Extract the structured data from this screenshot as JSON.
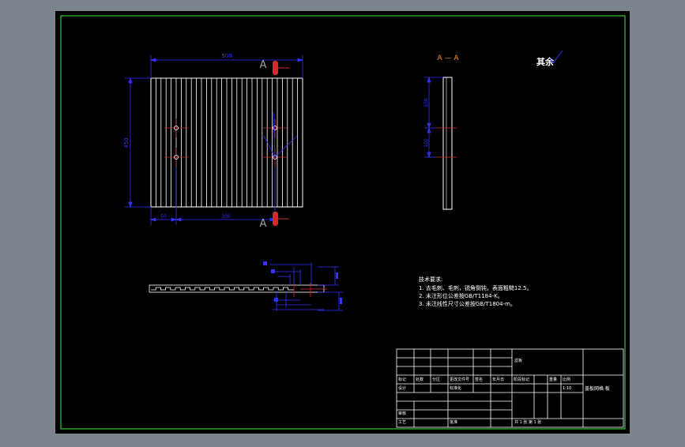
{
  "colors": {
    "background": "#7b848d",
    "sheet": "#000000",
    "border": "#39c739",
    "outline": "#ffffff",
    "dimension": "#3232ff",
    "centerline": "#d32b2b",
    "section_label": "#ff8c1a"
  },
  "main_view": {
    "section_label_top": "A",
    "section_label_bottom": "A",
    "dim_total_width": "500",
    "dim_height": "450",
    "dim_bottom_left": "50",
    "dim_bottom_mid": "300"
  },
  "section_view": {
    "title": "A — A",
    "dim_upper": "150",
    "dim_lower": "100"
  },
  "roughness_note": "其余",
  "tech_requirements": {
    "heading": "技术要求:",
    "items": [
      "1. 去毛刺、毛刺，锐角倒钝，表面粗糙12.5。",
      "2. 未注形位公差按GB/T1184-K。",
      "3. 未注线性尺寸公差按GB/T1804-m。"
    ]
  },
  "title_block": {
    "part_name": "滤板",
    "scale_value": "1:10",
    "drawing_name": "盖板网格 板",
    "row_headers": [
      "标记",
      "处数",
      "分区",
      "更改文件号",
      "签名",
      "年月日"
    ],
    "labels": {
      "design": "设计",
      "standardization": "标准化",
      "stage_mark": "阶段标记",
      "weight": "重量",
      "scale": "比例",
      "review": "审核",
      "process": "工艺",
      "approve": "批准",
      "sheet_info": "共 1 张  第 1 张"
    }
  }
}
